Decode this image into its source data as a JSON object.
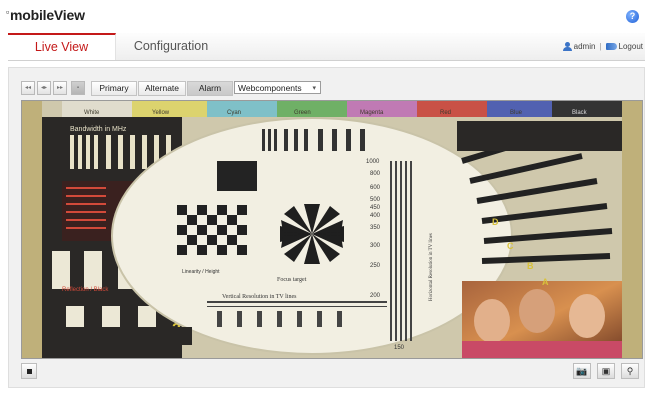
{
  "app": {
    "logo_text": "mobileView",
    "help_label": "?"
  },
  "nav": {
    "tabs": [
      {
        "label": "Live View",
        "active": true
      },
      {
        "label": "Configuration",
        "active": false
      }
    ],
    "user": {
      "name": "admin",
      "separator": "|",
      "logout_label": "Logout"
    }
  },
  "toolbar": {
    "window_buttons": [
      "1×1",
      "2×2",
      "3×3",
      "full"
    ],
    "streams": [
      {
        "label": "Primary",
        "active": false
      },
      {
        "label": "Alternate",
        "active": false
      },
      {
        "label": "Alarm",
        "active": true
      }
    ],
    "plugin_select": {
      "value": "Webcomponents"
    }
  },
  "video": {
    "test_chart_labels": {
      "bandwidth": "Bandwidth in MHz",
      "resolution_lines": "Vertical Resolution in TV lines",
      "horizontal_res": "Horizontal Resolution in TV lines",
      "focus_target": "Focus target",
      "linearity": "Linearity / Height",
      "reflection": "Reflection / Black",
      "colors": [
        "White",
        "Yellow",
        "Cyan",
        "Green",
        "Magenta",
        "Red",
        "Blue",
        "Black"
      ],
      "scale_numbers": [
        "1000",
        "800",
        "600",
        "500",
        "450",
        "400",
        "350",
        "300",
        "250",
        "200",
        "150"
      ],
      "chart_marks": [
        "1",
        "2",
        "A",
        "B",
        "C",
        "D"
      ]
    },
    "accent_colors": {
      "chart_red": "#c8233b",
      "chart_yellow": "#e8cf45"
    }
  },
  "controls": {
    "stop_icon": "stop-icon",
    "snapshot_icon": "camera-icon",
    "record_icon": "record-icon",
    "zoom_icon": "zoom-icon"
  }
}
